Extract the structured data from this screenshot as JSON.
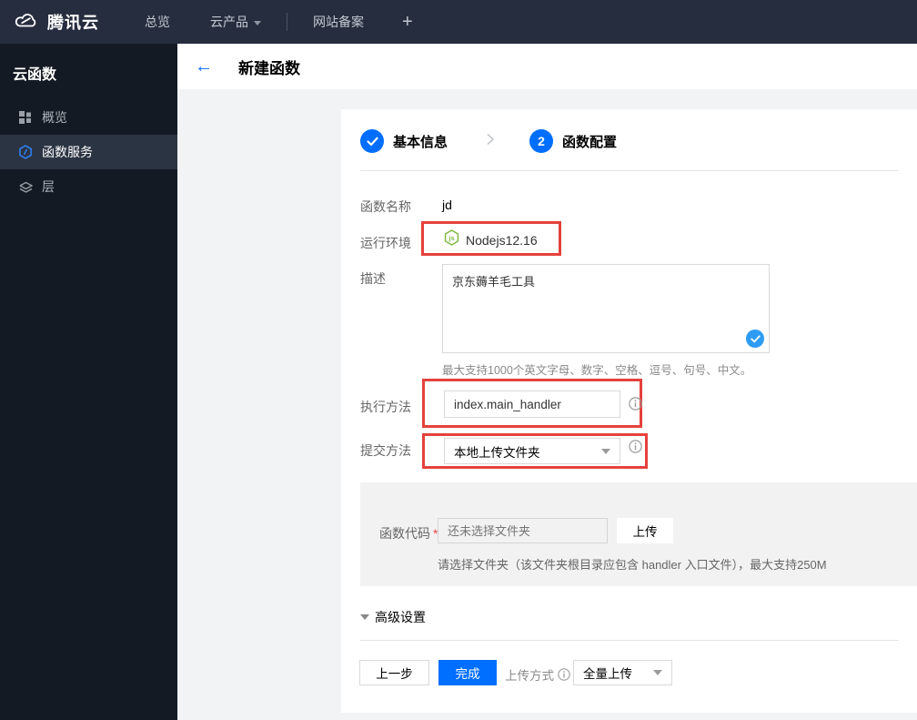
{
  "navbar": {
    "brand": "腾讯云",
    "overview": "总览",
    "products": "云产品",
    "beian": "网站备案",
    "plus": "+"
  },
  "sidebar": {
    "title": "云函数",
    "items": [
      {
        "label": "概览",
        "icon": "grid-icon"
      },
      {
        "label": "函数服务",
        "icon": "scf-hexagon-icon"
      },
      {
        "label": "层",
        "icon": "layers-icon"
      }
    ]
  },
  "header": {
    "back": "←",
    "title": "新建函数"
  },
  "stepper": {
    "step1_label": "基本信息",
    "step1_state": "done",
    "step2_number": "2",
    "step2_label": "函数配置"
  },
  "form": {
    "name_label": "函数名称",
    "name_value": "jd",
    "runtime_label": "运行环境",
    "runtime_value": "Nodejs12.16",
    "runtime_icon": "nodejs-icon",
    "desc_label": "描述",
    "desc_value": "京东薅羊毛工具",
    "desc_helper": "最大支持1000个英文字母、数字、空格、逗号、句号、中文。",
    "handler_label": "执行方法",
    "handler_value": "index.main_handler",
    "submit_label": "提交方法",
    "submit_value": "本地上传文件夹",
    "code_label": "函数代码",
    "code_required": "*",
    "code_placeholder": "还未选择文件夹",
    "upload_button": "上传",
    "code_helper": "请选择文件夹（该文件夹根目录应包含 handler 入口文件），最大支持250M",
    "advanced_label": "高级设置"
  },
  "footer": {
    "prev_button": "上一步",
    "finish_button": "完成",
    "upload_mode_label": "上传方式",
    "upload_mode_value": "全量上传"
  },
  "colors": {
    "accent_blue": "#006eff",
    "highlight_red": "#e5413c",
    "node_green": "#7fba42",
    "navbar_bg": "#262d3f",
    "sidebar_bg": "#141a23"
  }
}
